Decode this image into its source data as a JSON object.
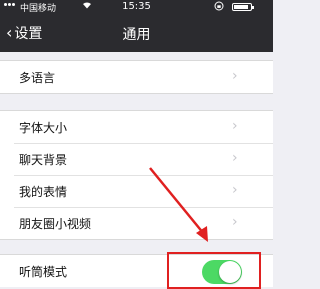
{
  "status_bar": {
    "carrier": "中国移动",
    "wifi_icon": "wifi-icon",
    "time": "15:35",
    "lock_icon": "orientation-lock-icon",
    "battery_level": 0.85
  },
  "nav": {
    "back_label": "设置",
    "title": "通用"
  },
  "groups": [
    {
      "items": [
        {
          "label": "多语言",
          "control": "chevron"
        }
      ]
    },
    {
      "items": [
        {
          "label": "字体大小",
          "control": "chevron"
        },
        {
          "label": "聊天背景",
          "control": "chevron"
        },
        {
          "label": "我的表情",
          "control": "chevron"
        },
        {
          "label": "朋友圈小视频",
          "control": "chevron"
        }
      ]
    },
    {
      "items": [
        {
          "label": "听筒模式",
          "control": "toggle",
          "on": true
        }
      ]
    }
  ],
  "colors": {
    "bar_background": "#2b2b2f",
    "toggle_on": "#4cd964",
    "annotation": "#e02020",
    "page_background": "#efeff4"
  }
}
